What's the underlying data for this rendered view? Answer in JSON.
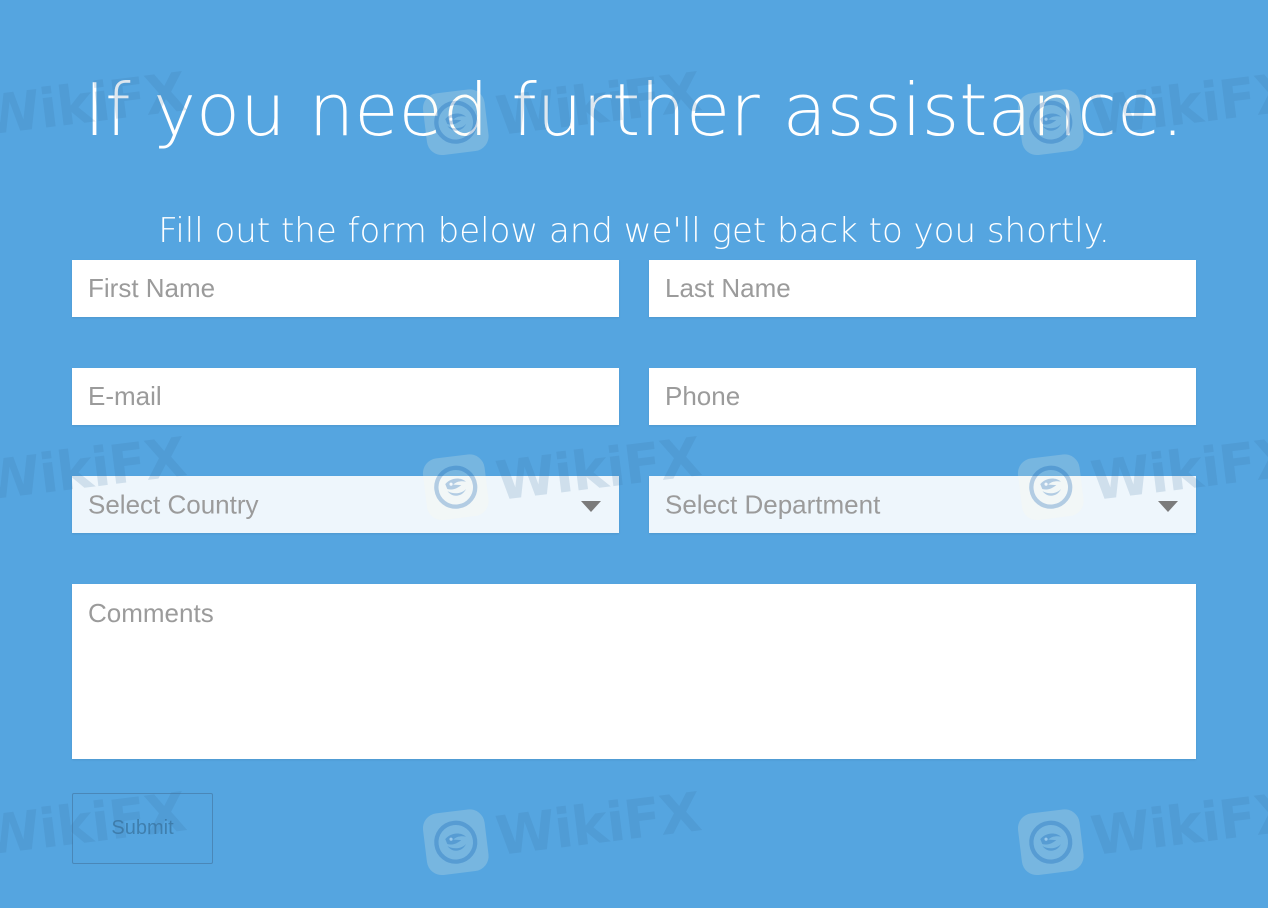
{
  "page": {
    "background_color": "#55a5e0",
    "headline": "If you need further assistance.",
    "subheadline": "Fill out the form below and we'll get back to you shortly."
  },
  "form": {
    "fields": {
      "first_name": {
        "placeholder": "First Name",
        "value": ""
      },
      "last_name": {
        "placeholder": "Last Name",
        "value": ""
      },
      "email": {
        "placeholder": "E-mail",
        "value": ""
      },
      "phone": {
        "placeholder": "Phone",
        "value": ""
      },
      "country": {
        "selected_label": "Select Country",
        "icon": "chevron-down-icon"
      },
      "department": {
        "selected_label": "Select Department",
        "icon": "chevron-down-icon"
      },
      "comments": {
        "placeholder": "Comments",
        "value": ""
      }
    },
    "submit_label": "Submit"
  },
  "watermark": {
    "text": "WikiFX",
    "icon": "wikifx-eagle-logo-icon",
    "text_color": "#3a70a0",
    "badge_color": "#fffae1"
  }
}
